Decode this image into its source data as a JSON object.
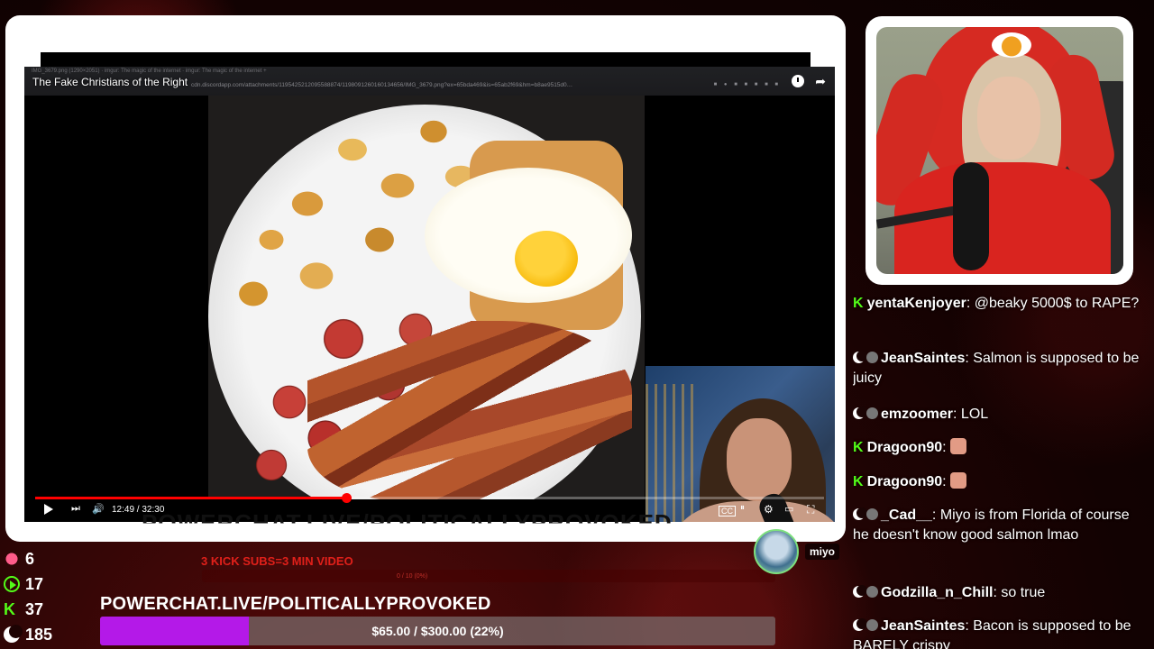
{
  "video": {
    "title": "The Fake Christians of the Right",
    "browser_tabs": "IMG_3679.png (1290×2051)   ·   imgur: The magic of the internet   ·   imgur: The magic of the internet   +",
    "browser_url": "cdn.discordapp.com/attachments/1195425212095588874/1198091260160134656/IMG_3679.png?ex=65bda469&is=65ab2f69&hm=b8ae9515d0…",
    "current_time": "12:49",
    "duration": "32:30",
    "time_display": "12:49 / 32:30",
    "progress": 0.3945
  },
  "ticker": {
    "text": "POWERCHAT.LIVE/POLITICALLYPROVOKED"
  },
  "chat": {
    "messages": [
      {
        "badge": "kick",
        "user": "yentaKenjoyer",
        "text": "@beaky 5000$ to RAPE?"
      },
      {
        "badge": "moon",
        "user": "JeanSaintes",
        "text": "Salmon is supposed to be juicy"
      },
      {
        "badge": "moon",
        "user": "emzoomer",
        "text": "LOL"
      },
      {
        "badge": "kick",
        "user": "Dragoon90",
        "text": ""
      },
      {
        "badge": "kick",
        "user": "Dragoon90",
        "text": ""
      },
      {
        "badge": "moon",
        "user": "_Cad__",
        "text": "Miyo is from Florida of course he doesn't know good salmon lmao"
      },
      {
        "badge": "moon",
        "user": "Godzilla_n_Chill",
        "text": "so true"
      },
      {
        "badge": "moon",
        "user": "JeanSaintes",
        "text": "Bacon is supposed to be BARELY crispy"
      }
    ]
  },
  "stats": {
    "gifts": "6",
    "rumble": "17",
    "kick": "37",
    "moon": "185"
  },
  "subs": {
    "goal_text": "3 KICK SUBS=3 MIN VIDEO",
    "bar_text": "0 / 10 (0%)"
  },
  "donation_goal": {
    "title": "POWERCHAT.LIVE/POLITICALLYPROVOKED",
    "amount_text": "$65.00 / $300.00 (22%)",
    "fraction": 0.22
  },
  "guest": {
    "name": "miyo"
  },
  "colors": {
    "kick_green": "#53fc18",
    "goal_purple": "#b419e8",
    "progress_red": "#ff0000"
  }
}
